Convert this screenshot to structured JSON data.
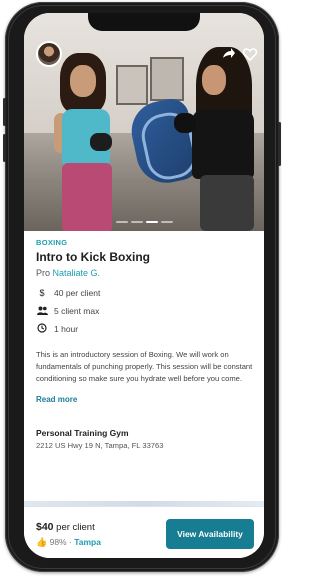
{
  "hero": {
    "photo_alt": "Two women training kickboxing with pads in a gym",
    "slide_count": 4,
    "active_slide": 3
  },
  "icons": {
    "avatar": "trainer-avatar",
    "share": "share-icon",
    "favorite": "heart-icon",
    "price": "dollar-icon",
    "capacity": "users-icon",
    "duration": "clock-icon",
    "rating": "thumbs-up-icon"
  },
  "session": {
    "category": "BOXING",
    "title": "Intro to Kick Boxing",
    "trainer_prefix": "Pro",
    "trainer_name": "Nataliate G.",
    "price": "40 per client",
    "capacity": "5 client max",
    "duration": "1 hour",
    "description": "This is an introductory session of Boxing. We will work on fundamentals of punching properly. This session will be constant conditioning so make sure you hydrate well before you come.",
    "read_more": "Read more"
  },
  "location": {
    "name": "Personal Training Gym",
    "address": "2212 US Hwy 19 N, Tampa, FL 33763"
  },
  "footer": {
    "price_amount": "$40",
    "price_unit": "per client",
    "rating": "98%",
    "separator": "·",
    "city": "Tampa",
    "cta": "View Availability"
  },
  "colors": {
    "accent": "#1b9fb2",
    "button": "#167d93"
  }
}
